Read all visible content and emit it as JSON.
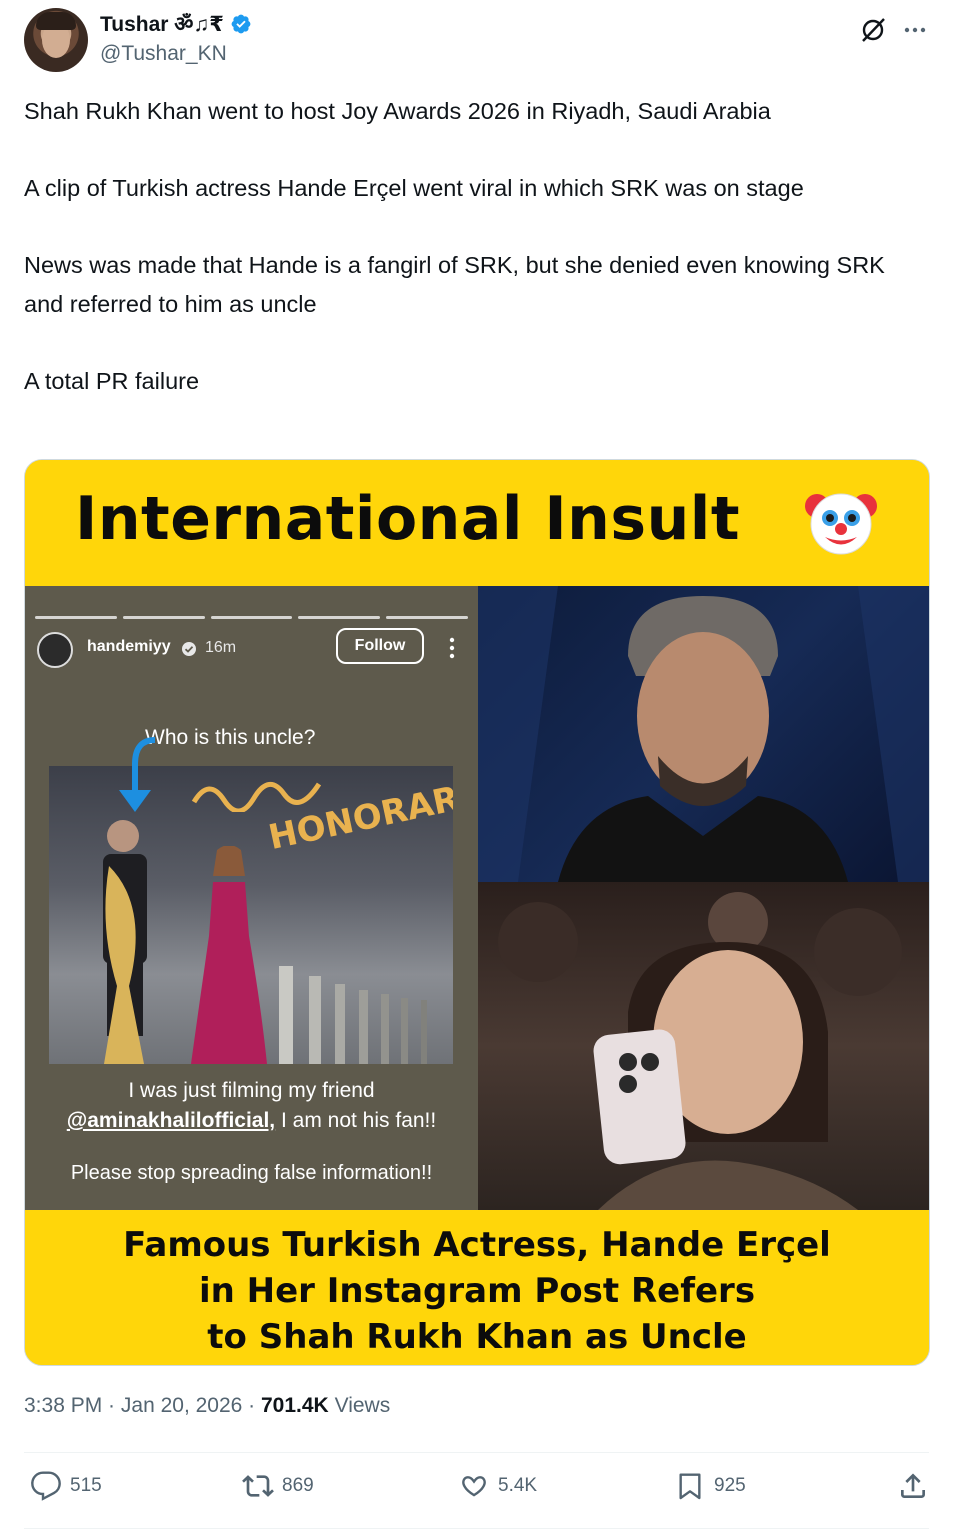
{
  "author": {
    "name": "Tushar ॐ♫₹",
    "handle": "@Tushar_KN",
    "verified": true
  },
  "tweet": {
    "paragraphs": [
      "Shah Rukh Khan went to host Joy Awards 2026 in Riyadh, Saudi Arabia",
      "A clip of Turkish actress Hande Erçel went viral in which SRK was on stage",
      "News was made that Hande is a fangirl of SRK, but she denied even knowing SRK and referred to him as uncle",
      "A total PR failure"
    ]
  },
  "media": {
    "headline": "International Insult",
    "headline_emoji": "clown-face",
    "story": {
      "username": "handemiyy",
      "time": "16m",
      "follow_label": "Follow",
      "question": "Who is this uncle?",
      "honorary": "HONORARY",
      "caption_line1": "I was just filming  my friend",
      "caption_mention": "@aminakhalilofficial,",
      "caption_line2_rest": " I am not his fan!!",
      "caption_line3": "Please stop spreading false information!!"
    },
    "footer_lines": [
      "Famous Turkish Actress, Hande Erçel",
      "in Her Instagram Post Refers",
      "to Shah Rukh Khan as Uncle"
    ]
  },
  "meta": {
    "time": "3:38 PM",
    "separator": " · ",
    "date": "Jan 20, 2026",
    "views_count": "701.4K",
    "views_label": "Views"
  },
  "actions": {
    "replies": "515",
    "reposts": "869",
    "likes": "5.4K",
    "bookmarks": "925"
  },
  "colors": {
    "accent_yellow": "#ffd60a",
    "verified_blue": "#1d9bf0",
    "secondary_text": "#536471"
  }
}
